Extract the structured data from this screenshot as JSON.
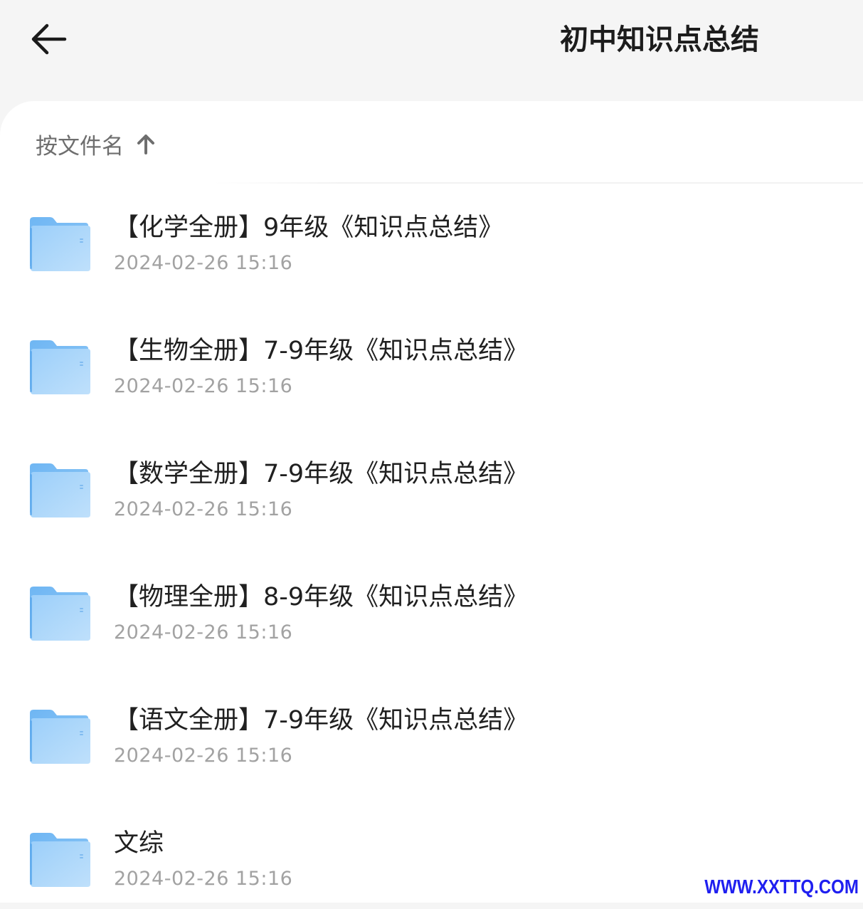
{
  "header": {
    "back_icon": "arrow-left-icon",
    "title": "初中知识点总结"
  },
  "sort": {
    "label": "按文件名",
    "direction_icon": "arrow-up-icon"
  },
  "files": [
    {
      "name": "【化学全册】9年级《知识点总结》",
      "date": "2024-02-26 15:16",
      "icon": "folder-icon"
    },
    {
      "name": "【生物全册】7-9年级《知识点总结》",
      "date": "2024-02-26 15:16",
      "icon": "folder-icon"
    },
    {
      "name": "【数学全册】7-9年级《知识点总结》",
      "date": "2024-02-26 15:16",
      "icon": "folder-icon"
    },
    {
      "name": "【物理全册】8-9年级《知识点总结》",
      "date": "2024-02-26 15:16",
      "icon": "folder-icon"
    },
    {
      "name": "【语文全册】7-9年级《知识点总结》",
      "date": "2024-02-26 15:16",
      "icon": "folder-icon"
    },
    {
      "name": "文综",
      "date": "2024-02-26 15:16",
      "icon": "folder-icon"
    }
  ],
  "watermark": "WWW.XXTTQ.COM",
  "colors": {
    "background": "#f5f5f5",
    "sheet": "#ffffff",
    "folder_light": "#bfe0fb",
    "folder_dark": "#6fb6f3",
    "title_text": "#1c1c1c",
    "date_text": "#a2a2a2",
    "watermark": "#1f1ff0"
  }
}
